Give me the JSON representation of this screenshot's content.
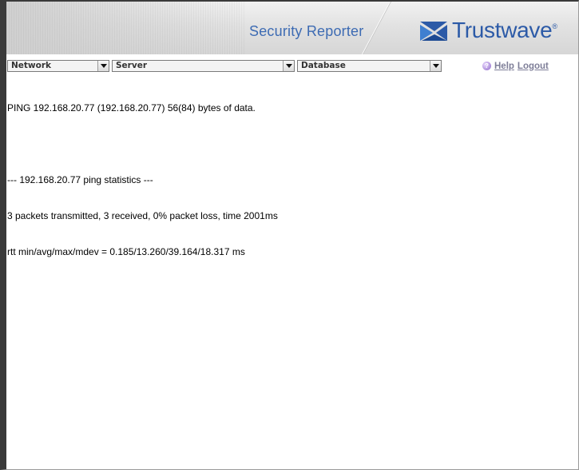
{
  "header": {
    "product_title": "Security Reporter",
    "brand_name": "Trustwave",
    "brand_reg": "®"
  },
  "navbar": {
    "selects": [
      {
        "label": "Network"
      },
      {
        "label": "Server"
      },
      {
        "label": "Database"
      }
    ],
    "help_label": "Help",
    "logout_label": "Logout"
  },
  "output": {
    "lines": [
      "PING 192.168.20.77 (192.168.20.77) 56(84) bytes of data.",
      "",
      "--- 192.168.20.77 ping statistics ---",
      "3 packets transmitted, 3 received, 0% packet loss, time 2001ms",
      "rtt min/avg/max/mdev = 0.185/13.260/39.164/18.317 ms"
    ]
  },
  "colors": {
    "accent": "#3d6bb3",
    "brand": "#2c5aa7",
    "link": "#7e7e98"
  },
  "icons": {
    "brand_logo": "trustwave-logo-icon",
    "help": "help-icon",
    "dropdown": "chevron-down-icon"
  }
}
